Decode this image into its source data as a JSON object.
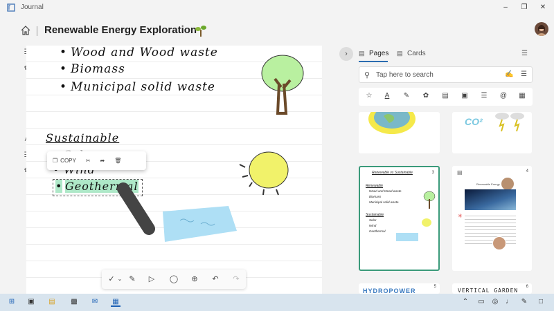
{
  "app": {
    "title": "Journal"
  },
  "header": {
    "page_title": "Renewable Energy Exploration"
  },
  "canvas": {
    "list_top": [
      "Wood and Wood waste",
      "Biomass",
      "Municipal solid waste"
    ],
    "heading": "Sustainable",
    "list_bottom": [
      "Solar",
      "Wind",
      "Geothermal"
    ]
  },
  "context_menu": {
    "copy_label": "COPY"
  },
  "panel": {
    "tabs": {
      "pages": "Pages",
      "cards": "Cards"
    },
    "search_placeholder": "Tap here to search",
    "thumbs": {
      "t3_title": "Renewable vs Sustainable",
      "t3_number": "3",
      "t3_renewable_heading": "Renewable",
      "t3_renewable_items": [
        "Wood and Wood waste",
        "Biomass",
        "Municipal solid waste"
      ],
      "t3_sustainable_heading": "Sustainable",
      "t3_sustainable_items": [
        "Solar",
        "Wind",
        "Geothermal"
      ],
      "t4_number": "4",
      "t4_title": "Renewable Energy",
      "t5_number": "5",
      "t5_title": "HYDROPOWER",
      "t6_number": "6",
      "t6_title": "VERTICAL GARDEN",
      "t2_label": "CO²"
    }
  }
}
